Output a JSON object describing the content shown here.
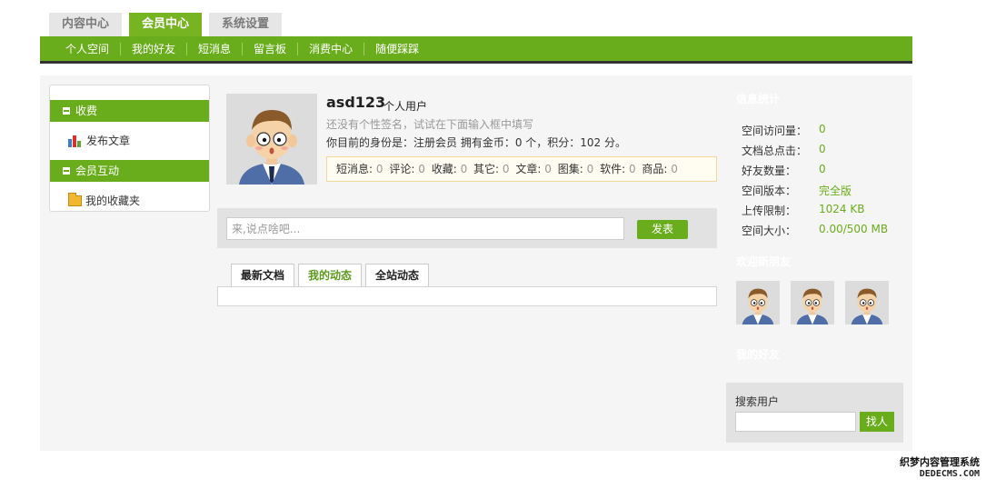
{
  "top_tabs": [
    {
      "label": "内容中心",
      "active": false
    },
    {
      "label": "会员中心",
      "active": true
    },
    {
      "label": "系统设置",
      "active": false
    }
  ],
  "nav_items": [
    "个人空间",
    "我的好友",
    "短消息",
    "留言板",
    "消费中心",
    "随便踩踩"
  ],
  "left_menu": {
    "section1": {
      "title": "收费",
      "item": "发布文章"
    },
    "section2": {
      "title": "会员互动",
      "item": "我的收藏夹"
    }
  },
  "profile": {
    "username": "asd123",
    "user_type": "个人用户",
    "signature": "还没有个性签名，试试在下面输入框中填写",
    "status": "你目前的身份是：注册会员 拥有金币：0 个，积分：102 分。"
  },
  "counts": [
    {
      "label": "短消息:",
      "value": "0"
    },
    {
      "label": "评论:",
      "value": "0"
    },
    {
      "label": "收藏:",
      "value": "0"
    },
    {
      "label": "其它:",
      "value": "0"
    },
    {
      "label": "文章:",
      "value": "0"
    },
    {
      "label": "图集:",
      "value": "0"
    },
    {
      "label": "软件:",
      "value": "0"
    },
    {
      "label": "商品:",
      "value": "0"
    }
  ],
  "post": {
    "placeholder": "来,说点啥吧...",
    "button": "发表"
  },
  "feed_tabs": [
    {
      "label": "最新文档",
      "active": false
    },
    {
      "label": "我的动态",
      "active": true
    },
    {
      "label": "全站动态",
      "active": false
    }
  ],
  "right": {
    "info_title": "信息统计",
    "stats": [
      {
        "label": "空间访问量：",
        "value": "0"
      },
      {
        "label": "文档总点击：",
        "value": "0"
      },
      {
        "label": "好友数量：",
        "value": "0"
      },
      {
        "label": "空间版本：",
        "value": "完全版"
      },
      {
        "label": "上传限制：",
        "value": "1024 KB"
      },
      {
        "label": "空间大小：",
        "value": "0.00/500 MB"
      }
    ],
    "visitors_title": "欢迎新朋友",
    "friends_title": "我的好友",
    "search_label": "搜索用户",
    "search_button": "找人"
  },
  "watermark": {
    "line1": "织梦内容管理系统",
    "line2": "DEDECMS.COM"
  },
  "colors": {
    "accent": "#6aad1c",
    "tab_active": "#77b422",
    "nav_border": "#333333"
  }
}
